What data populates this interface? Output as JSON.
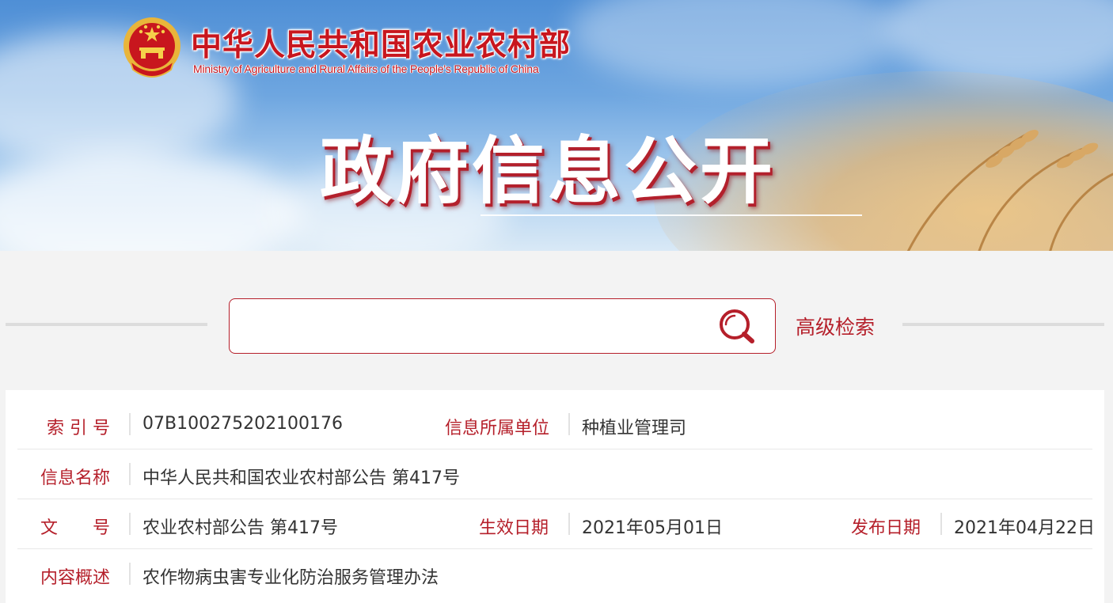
{
  "header": {
    "ministry_cn": "中华人民共和国农业农村部",
    "ministry_en": "Ministry of Agriculture and Rural Affairs of the People's Republic of China",
    "page_title": "政府信息公开"
  },
  "search": {
    "placeholder": "",
    "advanced_label": "高级检索"
  },
  "info": {
    "index_label": "索 引 号",
    "index_value": "07B100275202100176",
    "unit_label": "信息所属单位",
    "unit_value": "种植业管理司",
    "name_label": "信息名称",
    "name_value": "中华人民共和国农业农村部公告 第417号",
    "doc_label": "文　　号",
    "doc_value": "农业农村部公告 第417号",
    "effective_label": "生效日期",
    "effective_value": "2021年05月01日",
    "publish_label": "发布日期",
    "publish_value": "2021年04月22日",
    "summary_label": "内容概述",
    "summary_value": "农作物病虫害专业化防治服务管理办法"
  },
  "colors": {
    "accent": "#b51f2a",
    "emblem_red": "#c8161e",
    "emblem_gold": "#f2c94c"
  },
  "icons": {
    "emblem": "national-emblem-icon",
    "search": "search-icon"
  }
}
